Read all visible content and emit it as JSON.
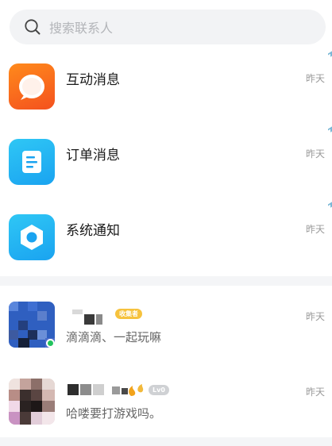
{
  "search": {
    "placeholder": "搜索联系人",
    "icon": "search-icon"
  },
  "system_messages": [
    {
      "title": "互动消息",
      "time": "昨天",
      "icon": "chat-bubble-icon",
      "color": "#f4511e"
    },
    {
      "title": "订单消息",
      "time": "昨天",
      "icon": "document-icon",
      "color": "#1aa3f0"
    },
    {
      "title": "系统通知",
      "time": "昨天",
      "icon": "settings-nut-icon",
      "color": "#1aa3f0"
    }
  ],
  "chats": [
    {
      "badge": "收集者",
      "preview": "滴滴滴、一起玩嘛",
      "time": "昨天",
      "online": true
    },
    {
      "badge": "Lv0",
      "preview": "哈喽要打游戏吗。",
      "time": "昨天",
      "online": false
    }
  ],
  "colors": {
    "online": "#22c35e",
    "badge_gold": "#f6c23d",
    "badge_grey": "#cfd1d4"
  }
}
